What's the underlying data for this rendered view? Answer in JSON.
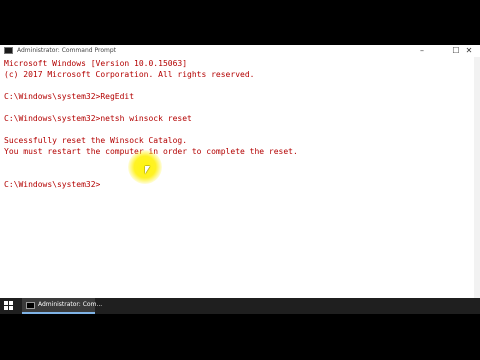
{
  "window": {
    "title": "Administrator: Command Prompt",
    "controls": {
      "minimize": "–",
      "maximize": "☐",
      "close": "✕"
    }
  },
  "console": {
    "lines": [
      "Microsoft Windows [Version 10.0.15063]",
      "(c) 2017 Microsoft Corporation. All rights reserved.",
      "",
      "C:\\Windows\\system32>RegEdit",
      "",
      "C:\\Windows\\system32>netsh winsock reset",
      "",
      "Sucessfully reset the Winsock Catalog.",
      "You must restart the computer in order to complete the reset.",
      "",
      "",
      "C:\\Windows\\system32>"
    ],
    "text_color": "#b30000"
  },
  "taskbar": {
    "start_icon": "windows-logo-icon",
    "items": [
      {
        "label": "Administrator: Com...",
        "icon": "cmd-icon"
      }
    ]
  }
}
